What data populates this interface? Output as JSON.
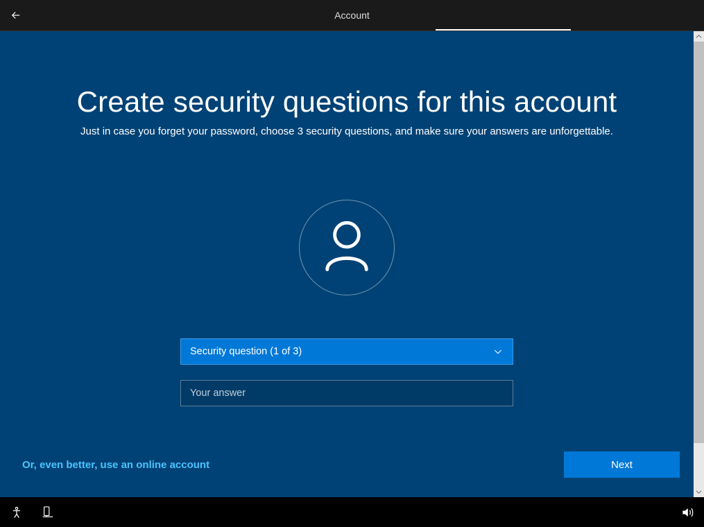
{
  "titlebar": {
    "title": "Account"
  },
  "page": {
    "heading": "Create security questions for this account",
    "subheading": "Just in case you forget your password, choose 3 security questions, and make sure your answers are unforgettable."
  },
  "form": {
    "dropdown_label": "Security question (1 of 3)",
    "answer_placeholder": "Your answer"
  },
  "footer": {
    "online_link": "Or, even better, use an online account",
    "next_button": "Next"
  }
}
